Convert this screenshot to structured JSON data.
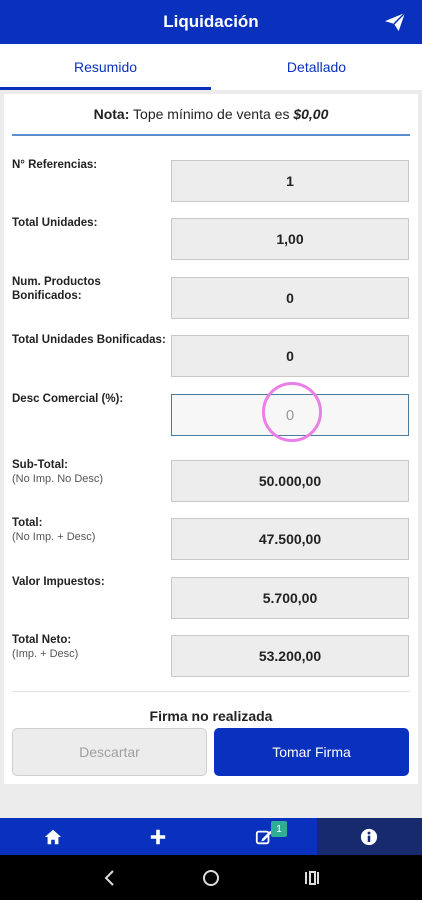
{
  "header": {
    "title": "Liquidación",
    "send_icon": "send-icon"
  },
  "tabs": [
    {
      "label": "Resumido",
      "active": true
    },
    {
      "label": "Detallado",
      "active": false
    }
  ],
  "note": {
    "prefix": "Nota:",
    "text": " Tope mínimo de venta es ",
    "value": "$0,00"
  },
  "fields": [
    {
      "label": "N° Referencias:",
      "sub": "",
      "value": "1"
    },
    {
      "label": "Total Unidades:",
      "sub": "",
      "value": "1,00"
    },
    {
      "label": "Num. Productos Bonificados:",
      "sub": "",
      "value": "0"
    },
    {
      "label": "Total Unidades Bonificadas:",
      "sub": "",
      "value": "0"
    },
    {
      "label": "Desc Comercial (%):",
      "sub": "",
      "value": "0"
    },
    {
      "label": "Sub-Total:",
      "sub": "(No Imp. No Desc)",
      "value": "50.000,00"
    },
    {
      "label": "Total:",
      "sub": "(No Imp. + Desc)",
      "value": "47.500,00"
    },
    {
      "label": "Valor Impuestos:",
      "sub": "",
      "value": "5.700,00"
    },
    {
      "label": "Total Neto:",
      "sub": "(Imp. + Desc)",
      "value": "53.200,00"
    }
  ],
  "signature": {
    "status": "Firma no realizada",
    "discard_label": "Descartar",
    "sign_label": "Tomar Firma"
  },
  "bottom_nav": {
    "badge": "1",
    "items": [
      "home-icon",
      "plus-icon",
      "edit-icon",
      "info-icon"
    ]
  },
  "colors": {
    "primary": "#0a31bd",
    "badge": "#2fae96",
    "highlight_ring": "#ea7fe6"
  }
}
